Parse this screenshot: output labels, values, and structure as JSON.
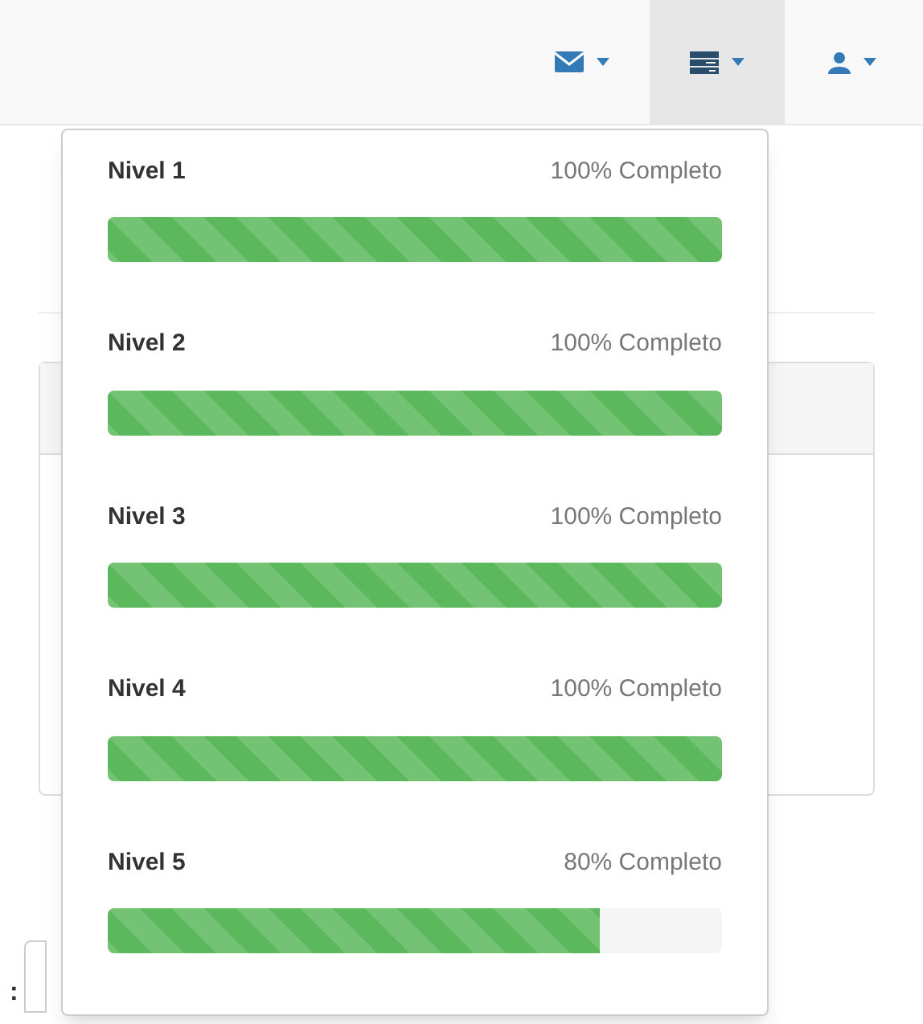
{
  "navbar": {
    "items": [
      {
        "kind": "mail",
        "selected": false
      },
      {
        "kind": "tasks",
        "selected": true
      },
      {
        "kind": "user",
        "selected": false
      }
    ]
  },
  "tasks_dropdown": {
    "items": [
      {
        "label": "Nivel 1",
        "reading": "100% Completo",
        "level": 1
      },
      {
        "label": "Nivel 2",
        "reading": "100% Completo",
        "level": 1
      },
      {
        "label": "Nivel 3",
        "reading": "100% Completo",
        "level": 1
      },
      {
        "label": "Nivel 4",
        "reading": "100% Completo",
        "level": 1
      },
      {
        "label": "Nivel 5",
        "reading": "80% Completo",
        "level": 0.8
      }
    ]
  },
  "background": {
    "label_fragment": ":"
  }
}
